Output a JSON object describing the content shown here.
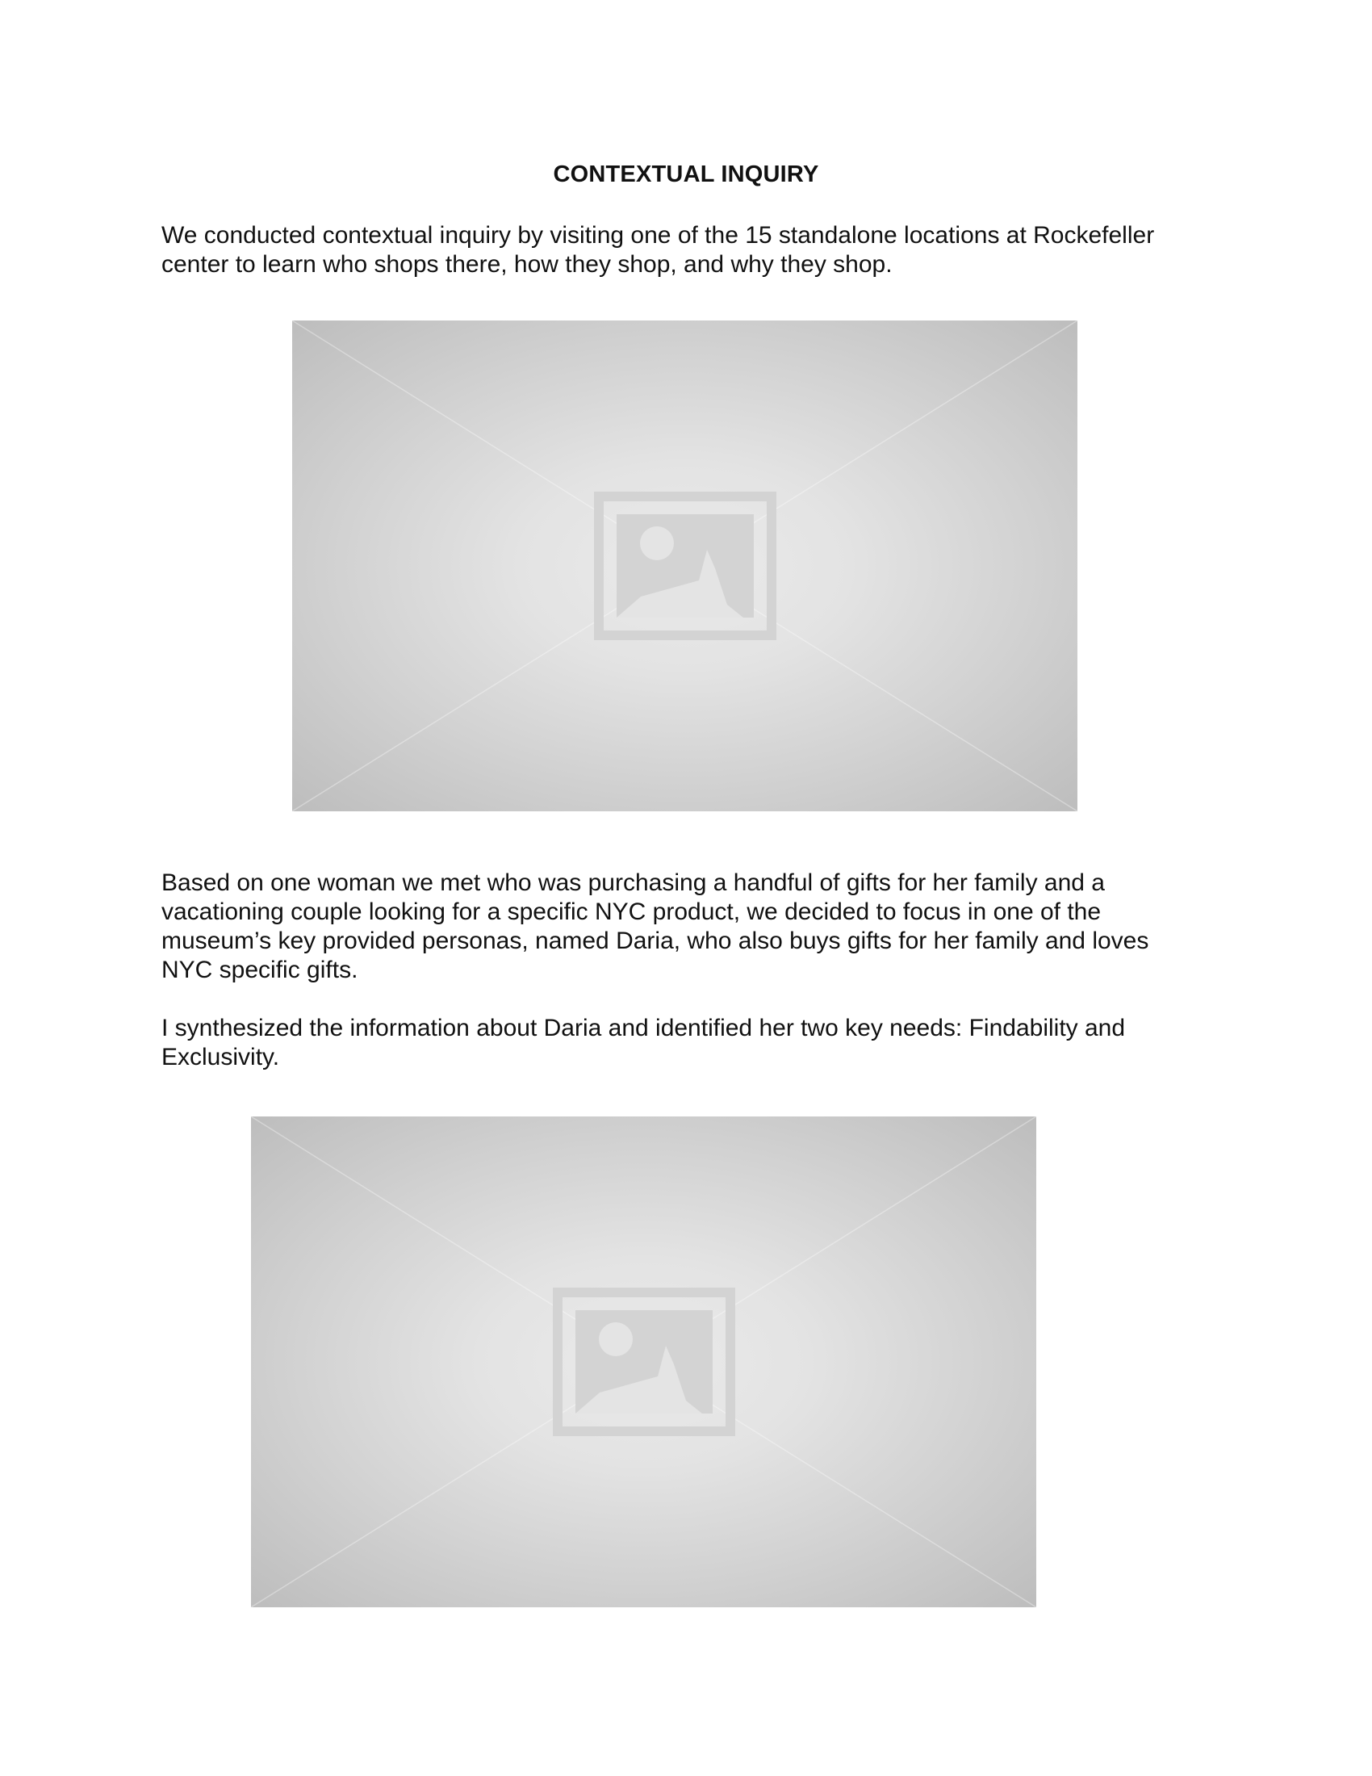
{
  "heading": "CONTEXTUAL INQUIRY",
  "paragraph_1": {
    "lines": [
      "We conducted contextual inquiry by visiting one of the 15 standalone locations at Rockefeller",
      "center to learn who shops there, how they shop, and why they shop."
    ]
  },
  "paragraph_2": {
    "lines": [
      "Based on one woman we met who was purchasing a handful of gifts for her family and a",
      "vacationing couple looking for a specific NYC product, we decided to focus in one of the",
      "museum’s key provided personas, named Daria, who also buys gifts for her family and loves",
      "NYC specific gifts."
    ]
  },
  "paragraph_3": {
    "lines": [
      "I synthesized the information about Daria and identified her two key needs: Findability and",
      "Exclusivity."
    ]
  },
  "images": [
    {
      "icon": "image-placeholder-icon"
    },
    {
      "icon": "image-placeholder-icon"
    }
  ],
  "colors": {
    "text": "#111111",
    "placeholder_center": "#eaeaea",
    "placeholder_edge": "#bdbdbd",
    "icon": "#d3d3d3"
  }
}
